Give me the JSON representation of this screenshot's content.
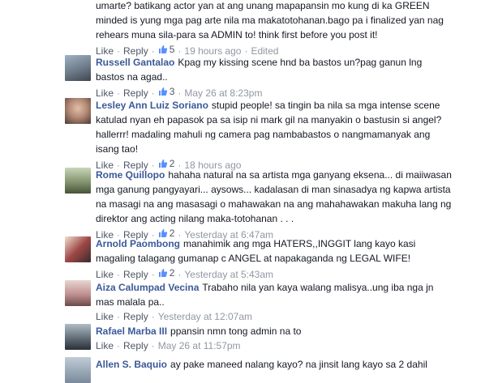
{
  "comments": [
    {
      "author": "",
      "text": "umarte? batikang actor yan at ang unang mapapansin mo kung di ka GREEN minded is yung mga pag arte nila ma makatotohanan.bago pa i finalized yan nag rehears muna sila-para sa ADMIN to! think first before you post it!",
      "like_label": "Like",
      "reply_label": "Reply",
      "likes": "5",
      "time": "19 hours ago",
      "extra": "Edited",
      "avatar_color": "#8a7060"
    },
    {
      "author": "Russell Gantalao",
      "text": "Kpag my kissing scene hnd ba bastos un?pag ganun lng bastos na agad..",
      "like_label": "Like",
      "reply_label": "Reply",
      "likes": "3",
      "time": "May 26 at 8:23pm",
      "extra": "",
      "avatar_color": "#6d7a88"
    },
    {
      "author": "Lesley Ann Luiz Soriano",
      "text": "stupid people! sa tingin ba nila sa mga intense scene katulad nyan eh papasok pa sa isip ni mark gil na manyakin o bastusin si angel? hallerrr! madaling mahuli ng camera pag nambabastos o nangmamanyak ang isang tao!",
      "like_label": "Like",
      "reply_label": "Reply",
      "likes": "2",
      "time": "18 hours ago",
      "extra": "",
      "avatar_color": "#b58a76"
    },
    {
      "author": "Rome Quillopo",
      "text": "hahaha natural na sa artista mga ganyang eksena... di maiiwasan mga ganung pangyayari... aysows... kadalasan di man sinasadya ng kapwa artista na masagi na ang masasagi o mahawakan na ang mahahawakan makuha lang ng direktor ang acting nilang maka-totohanan . . .",
      "like_label": "Like",
      "reply_label": "Reply",
      "likes": "2",
      "time": "Yesterday at 6:47am",
      "extra": "",
      "avatar_color": "#7d8f6a"
    },
    {
      "author": "Arnold Paombong",
      "text": "manahimik ang mga HATERS,,INGGIT lang kayo kasi magaling talagang gumanap c ANGEL at napakaganda ng LEGAL WIFE!",
      "like_label": "Like",
      "reply_label": "Reply",
      "likes": "2",
      "time": "Yesterday at 5:43am",
      "extra": "",
      "avatar_color": "#a04848"
    },
    {
      "author": "Aiza Calumpad Vecina",
      "text": "Trabaho nila yan kaya walang malisya..ung iba nga jn mas malala pa..",
      "like_label": "Like",
      "reply_label": "Reply",
      "likes": "",
      "time": "Yesterday at 12:07am",
      "extra": "",
      "avatar_color": "#c09090"
    },
    {
      "author": "Rafael Marba III",
      "text": "ppansin nmn tong admin na to",
      "like_label": "Like",
      "reply_label": "Reply",
      "likes": "",
      "time": "May 26 at 11:57pm",
      "extra": "",
      "avatar_color": "#5a6670"
    },
    {
      "author": "Allen S. Baquio",
      "text": "ay pake maneed nalang kayo? na jinsit lang kayo sa 2 dahil",
      "like_label": "",
      "reply_label": "",
      "likes": "",
      "time": "",
      "extra": "",
      "avatar_color": "#7a8a9a"
    }
  ],
  "colors": {
    "link": "#3b5998",
    "meta": "#9197a3",
    "text": "#141823"
  }
}
